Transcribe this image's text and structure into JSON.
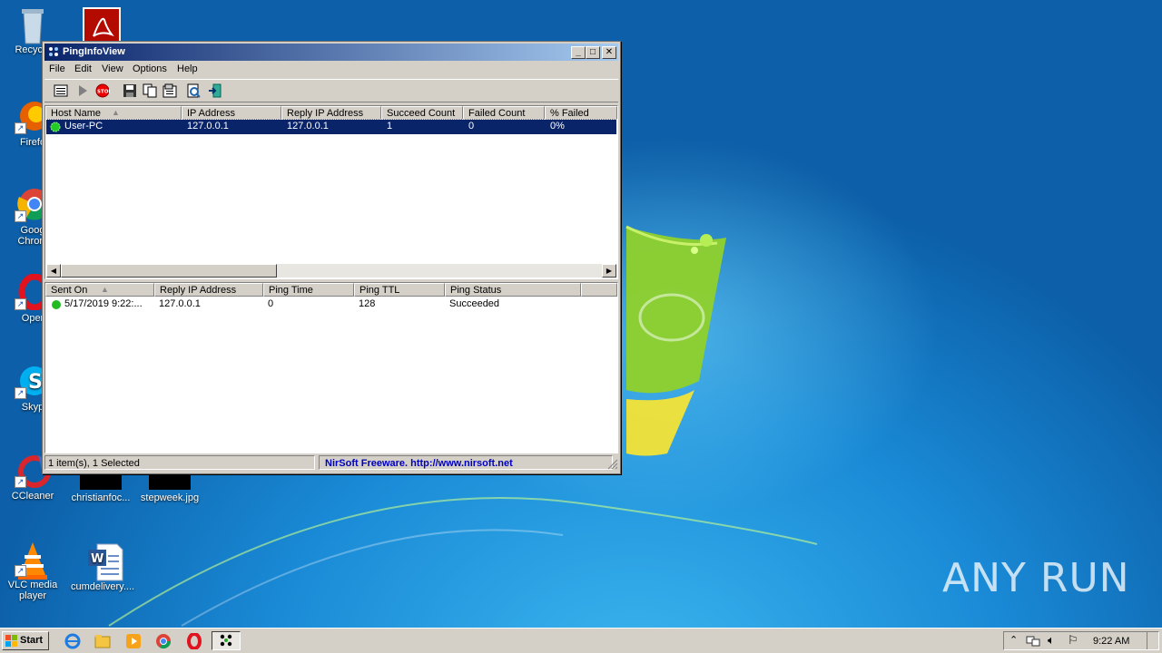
{
  "desktop": {
    "icons": [
      {
        "label": "Recycle",
        "icon": "recycle-bin-icon"
      },
      {
        "label": "Firefo",
        "icon": "firefox-icon"
      },
      {
        "label": "Goog Chrom",
        "icon": "chrome-icon"
      },
      {
        "label": "Oper",
        "icon": "opera-icon"
      },
      {
        "label": "Skyp",
        "icon": "skype-icon"
      },
      {
        "label": "CCleaner",
        "icon": "ccleaner-icon"
      },
      {
        "label": "christianfoc...",
        "icon": "file-icon"
      },
      {
        "label": "stepweek.jpg",
        "icon": "image-file-icon"
      },
      {
        "label": "VLC media player",
        "icon": "vlc-icon"
      },
      {
        "label": "cumdelivery....",
        "icon": "word-doc-icon"
      }
    ],
    "watermark": "ANY RUN"
  },
  "window": {
    "title": "PingInfoView",
    "controls": {
      "minimize": "_",
      "maximize": "□",
      "close": "✕"
    },
    "menu": [
      "File",
      "Edit",
      "View",
      "Options",
      "Help"
    ],
    "top_list": {
      "headers": [
        "Host Name",
        "IP Address",
        "Reply IP Address",
        "Succeed Count",
        "Failed Count",
        "% Failed"
      ],
      "rows": [
        {
          "host": "User-PC",
          "ip": "127.0.0.1",
          "reply_ip": "127.0.0.1",
          "succeed": "1",
          "failed": "0",
          "pct_failed": "0%"
        }
      ]
    },
    "bottom_list": {
      "headers": [
        "Sent On",
        "Reply IP Address",
        "Ping Time",
        "Ping TTL",
        "Ping Status"
      ],
      "rows": [
        {
          "sent_on": "5/17/2019 9:22:...",
          "reply_ip": "127.0.0.1",
          "ping_time": "0",
          "ping_ttl": "128",
          "status": "Succeeded"
        }
      ]
    },
    "status": {
      "items": "1 item(s), 1 Selected",
      "credit": "NirSoft Freeware.  http://www.nirsoft.net"
    }
  },
  "taskbar": {
    "start_label": "Start",
    "clock": "9:22 AM"
  },
  "colors": {
    "title_active": "#0a246a",
    "selection": "#0a246a",
    "status_ok": "#22bb22",
    "nirsoft_link": "#0000c0"
  }
}
